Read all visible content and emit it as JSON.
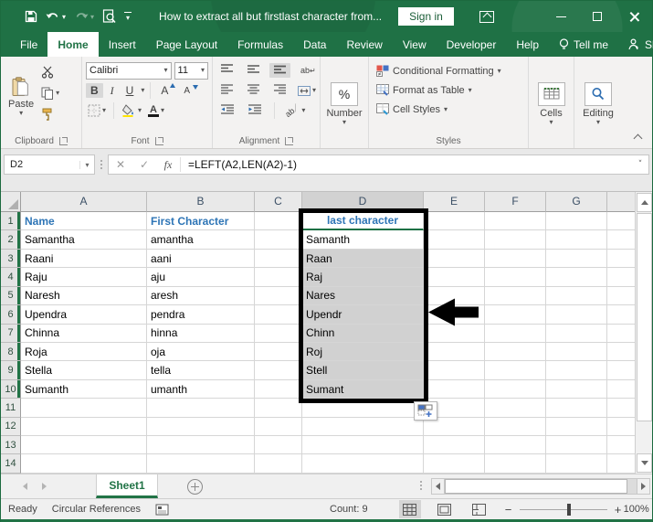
{
  "titlebar": {
    "title": "How to extract all but firstlast character from...",
    "sign_in": "Sign in"
  },
  "tabs": [
    {
      "label": "File",
      "active": false,
      "icon": null
    },
    {
      "label": "Home",
      "active": true,
      "icon": null
    },
    {
      "label": "Insert",
      "active": false,
      "icon": null
    },
    {
      "label": "Page Layout",
      "active": false,
      "icon": null
    },
    {
      "label": "Formulas",
      "active": false,
      "icon": null
    },
    {
      "label": "Data",
      "active": false,
      "icon": null
    },
    {
      "label": "Review",
      "active": false,
      "icon": null
    },
    {
      "label": "View",
      "active": false,
      "icon": null
    },
    {
      "label": "Developer",
      "active": false,
      "icon": null
    },
    {
      "label": "Help",
      "active": false,
      "icon": null
    },
    {
      "label": "Tell me",
      "active": false,
      "icon": "bulb"
    },
    {
      "label": "Share",
      "active": false,
      "icon": "person"
    }
  ],
  "ribbon": {
    "clipboard_label": "Clipboard",
    "paste_label": "Paste",
    "font_label": "Font",
    "font_name": "Calibri",
    "font_size": "11",
    "bold": "B",
    "italic": "I",
    "underline": "U",
    "alignment_label": "Alignment",
    "number_label": "Number",
    "percent": "%",
    "styles_label": "Styles",
    "conditional_formatting": "Conditional Formatting",
    "format_as_table": "Format as Table",
    "cell_styles": "Cell Styles",
    "cells_label": "Cells",
    "editing_label": "Editing"
  },
  "formula_bar": {
    "name_box": "D2",
    "fx": "fx",
    "formula": "=LEFT(A2,LEN(A2)-1)"
  },
  "grid": {
    "columns": [
      "A",
      "B",
      "C",
      "D",
      "E",
      "F",
      "G"
    ],
    "row_count": 14,
    "selected_column": "D",
    "selected_rows_span": [
      1,
      10
    ],
    "rows": [
      {
        "n": 1,
        "a": "Name",
        "b": "First Character",
        "d": "last character"
      },
      {
        "n": 2,
        "a": "Samantha",
        "b": "amantha",
        "d": "Samanth"
      },
      {
        "n": 3,
        "a": "Raani",
        "b": "aani",
        "d": "Raan"
      },
      {
        "n": 4,
        "a": "Raju",
        "b": "aju",
        "d": "Raj"
      },
      {
        "n": 5,
        "a": "Naresh",
        "b": "aresh",
        "d": "Nares"
      },
      {
        "n": 6,
        "a": "Upendra",
        "b": "pendra",
        "d": "Upendr"
      },
      {
        "n": 7,
        "a": "Chinna",
        "b": "hinna",
        "d": "Chinn"
      },
      {
        "n": 8,
        "a": "Roja",
        "b": "oja",
        "d": "Roj"
      },
      {
        "n": 9,
        "a": "Stella",
        "b": "tella",
        "d": "Stell"
      },
      {
        "n": 10,
        "a": "Sumanth",
        "b": "umanth",
        "d": "Sumant"
      }
    ]
  },
  "sheetbar": {
    "sheet_name": "Sheet1"
  },
  "statusbar": {
    "ready": "Ready",
    "circular": "Circular References",
    "count": "Count: 9",
    "zoom_value": "100%"
  },
  "colors": {
    "accent_green": "#217346",
    "header_blue": "#2e75b6",
    "selection_fill": "#d1d1d1"
  }
}
